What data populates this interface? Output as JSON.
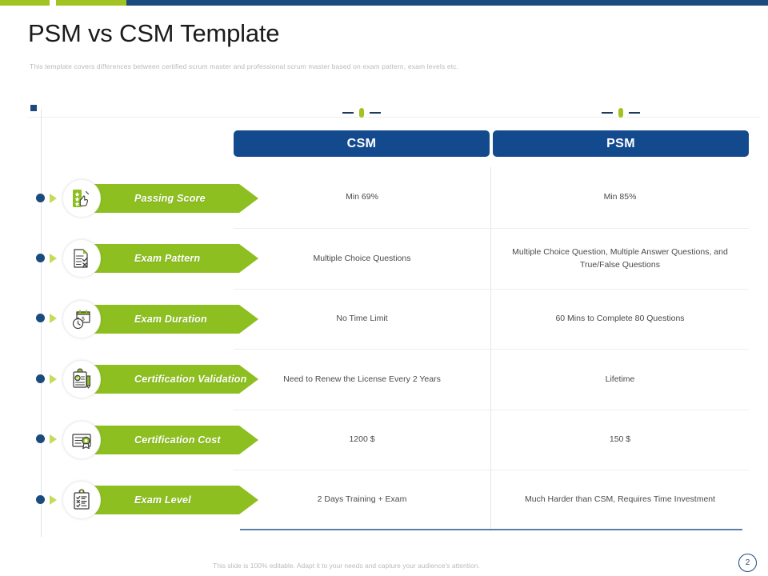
{
  "topbar": {
    "green": "#a2c422",
    "blue": "#1b4a7e"
  },
  "header": {
    "title": "PSM vs CSM Template",
    "subtitle": "This template covers differences between certified scrum master and professional scrum master based on exam pattern, exam levels etc."
  },
  "theme": {
    "accent_green": "#8cbf1f",
    "accent_blue": "#134a8e",
    "rail_blue": "#1b4a7e",
    "marker_green": "#a2c422"
  },
  "columns": [
    {
      "id": "csm",
      "label": "CSM"
    },
    {
      "id": "psm",
      "label": "PSM"
    }
  ],
  "rows": [
    {
      "label": "Passing Score",
      "icon": "scorecard-stars-hand-icon",
      "csm": "Min 69%",
      "psm": "Min 85%"
    },
    {
      "label": "Exam Pattern",
      "icon": "document-checklist-icon",
      "csm": "Multiple Choice Questions",
      "psm": "Multiple Choice Question, Multiple Answer Questions, and True/False Questions"
    },
    {
      "label": "Exam Duration",
      "icon": "stopwatch-calendar-icon",
      "csm": "No Time Limit",
      "psm": "60 Mins to Complete 80 Questions"
    },
    {
      "label": "Certification Validation",
      "icon": "clipboard-approved-pencil-icon",
      "csm": "Need to Renew the License Every 2 Years",
      "psm": "Lifetime"
    },
    {
      "label": "Certification Cost",
      "icon": "certificate-award-icon",
      "csm": "1200 $",
      "psm": "150 $"
    },
    {
      "label": "Exam Level",
      "icon": "clipboard-checklist-icon",
      "csm": "2 Days Training + Exam",
      "psm": "Much Harder than CSM, Requires Time Investment"
    }
  ],
  "footer": {
    "note": "This slide is 100% editable. Adapt it to your needs and capture your audience's attention.",
    "page_number": "2"
  }
}
